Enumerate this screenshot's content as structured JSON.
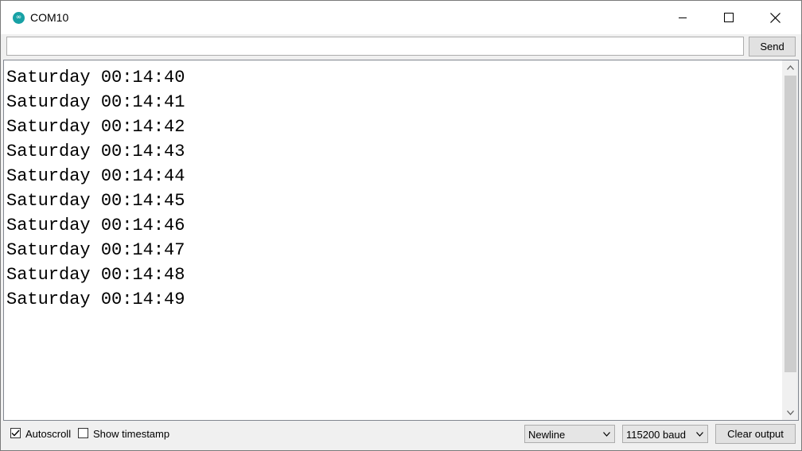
{
  "window": {
    "title": "COM10",
    "app_icon": "arduino-logo-icon",
    "controls": [
      "minimize-icon",
      "maximize-icon",
      "close-icon"
    ]
  },
  "input_bar": {
    "value": "",
    "send_label": "Send"
  },
  "output": {
    "lines": [
      "Saturday 00:14:40",
      "Saturday 00:14:41",
      "Saturday 00:14:42",
      "Saturday 00:14:43",
      "Saturday 00:14:44",
      "Saturday 00:14:45",
      "Saturday 00:14:46",
      "Saturday 00:14:47",
      "Saturday 00:14:48",
      "Saturday 00:14:49"
    ]
  },
  "statusbar": {
    "autoscroll": {
      "label": "Autoscroll",
      "checked": true
    },
    "timestamp": {
      "label": "Show timestamp",
      "checked": false
    },
    "line_ending": {
      "selected": "Newline"
    },
    "baud": {
      "selected": "115200 baud"
    },
    "clear_label": "Clear output"
  },
  "colors": {
    "accent": "#17a1a5",
    "chrome": "#f0f0f0",
    "scroll_thumb": "#cdcdcd"
  }
}
